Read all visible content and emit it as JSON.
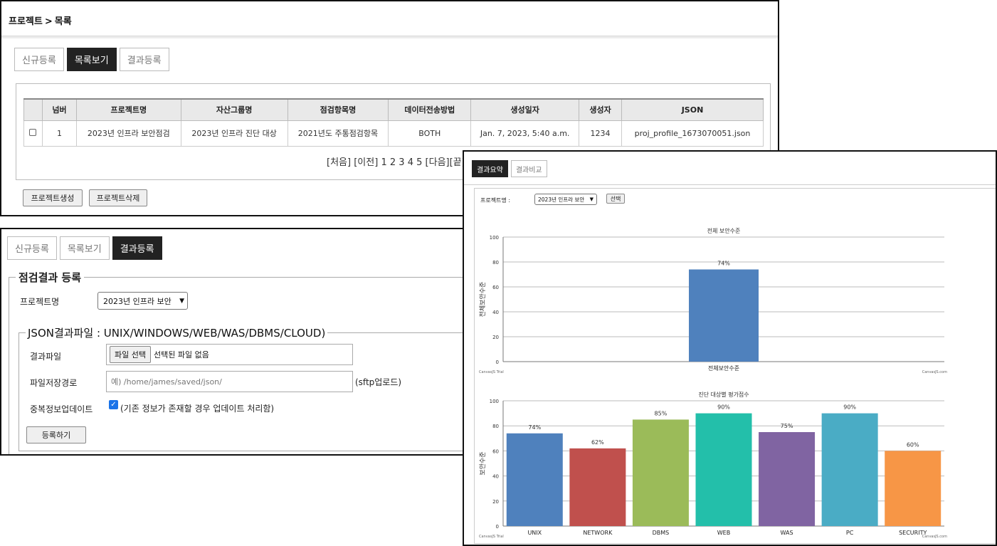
{
  "project_list": {
    "breadcrumb": {
      "section": "프로젝트",
      "separator": ">",
      "page": "목록"
    },
    "tabs": [
      "신규등록",
      "목록보기",
      "결과등록"
    ],
    "active_tab": 1,
    "table": {
      "headers": [
        "넘버",
        "프로젝트명",
        "자산그룹명",
        "점검항목명",
        "데이터전송방법",
        "생성일자",
        "생성자",
        "JSON"
      ],
      "rows": [
        [
          "1",
          "2023년 인프라 보안점검",
          "2023년 인프라 진단 대상",
          "2021년도 주통점검항목",
          "BOTH",
          "Jan. 7, 2023, 5:40 a.m.",
          "1234",
          "proj_profile_1673070051.json"
        ]
      ]
    },
    "pagination": {
      "first": "[처음]",
      "prev": "[이전]",
      "pages": [
        "1",
        "2",
        "3",
        "4",
        "5"
      ],
      "next": "[다음]",
      "last": "[끝]"
    },
    "buttons": {
      "create": "프로젝트생성",
      "delete": "프로젝트삭제"
    }
  },
  "result_register": {
    "tabs": [
      "신규등록",
      "목록보기",
      "결과등록"
    ],
    "active_tab": 2,
    "legend": "점검결과 등록",
    "project_label": "프로젝트명",
    "project_selected": "2023년 인프라 보안",
    "file_legend": "JSON결과파일 : UNIX/WINDOWS/WEB/WAS/DBMS/CLOUD)",
    "result_file_label": "결과파일",
    "file_button": "파일 선택",
    "file_status": "선택된 파일 없음",
    "save_path_label": "파일저장경로",
    "save_path_placeholder": "예) /home/james/saved/json/",
    "save_path_suffix": "(sftp업로드)",
    "duplicate_label": "중복정보업데이트",
    "duplicate_checked": true,
    "duplicate_text": "(기존 정보가 존재할 경우 업데이트 처리함)",
    "submit_button": "등록하기"
  },
  "result_summary": {
    "tabs": [
      "결과요약",
      "결과비교"
    ],
    "active_tab": 0,
    "project_label": "프로젝트명 :",
    "project_selected": "2023년 인프라 보안",
    "select_button": "선택",
    "watermark_left": "CanvasJS Trial",
    "watermark_right": "CanvasJS.com"
  },
  "chart_data": [
    {
      "type": "bar",
      "title": "전체 보안수준",
      "xlabel": "",
      "ylabel": "전체보안수준",
      "ylim": [
        0,
        100
      ],
      "yticks": [
        0,
        20,
        40,
        60,
        80,
        100
      ],
      "grid": true,
      "categories": [
        "전체보안수준"
      ],
      "values": [
        74
      ],
      "value_labels": [
        "74%"
      ],
      "colors": [
        "#4f81bd"
      ]
    },
    {
      "type": "bar",
      "title": "진단 대상별 평가점수",
      "xlabel": "",
      "ylabel": "보안수준",
      "ylim": [
        0,
        100
      ],
      "yticks": [
        0,
        20,
        40,
        60,
        80,
        100
      ],
      "grid": true,
      "categories": [
        "UNIX",
        "NETWORK",
        "DBMS",
        "WEB",
        "WAS",
        "PC",
        "SECURITY"
      ],
      "values": [
        74,
        62,
        85,
        90,
        75,
        90,
        60
      ],
      "value_labels": [
        "74%",
        "62%",
        "85%",
        "90%",
        "75%",
        "90%",
        "60%"
      ],
      "colors": [
        "#4f81bd",
        "#c0504d",
        "#9bbb59",
        "#23bfaa",
        "#8064a2",
        "#4aacc5",
        "#f79646"
      ]
    }
  ]
}
